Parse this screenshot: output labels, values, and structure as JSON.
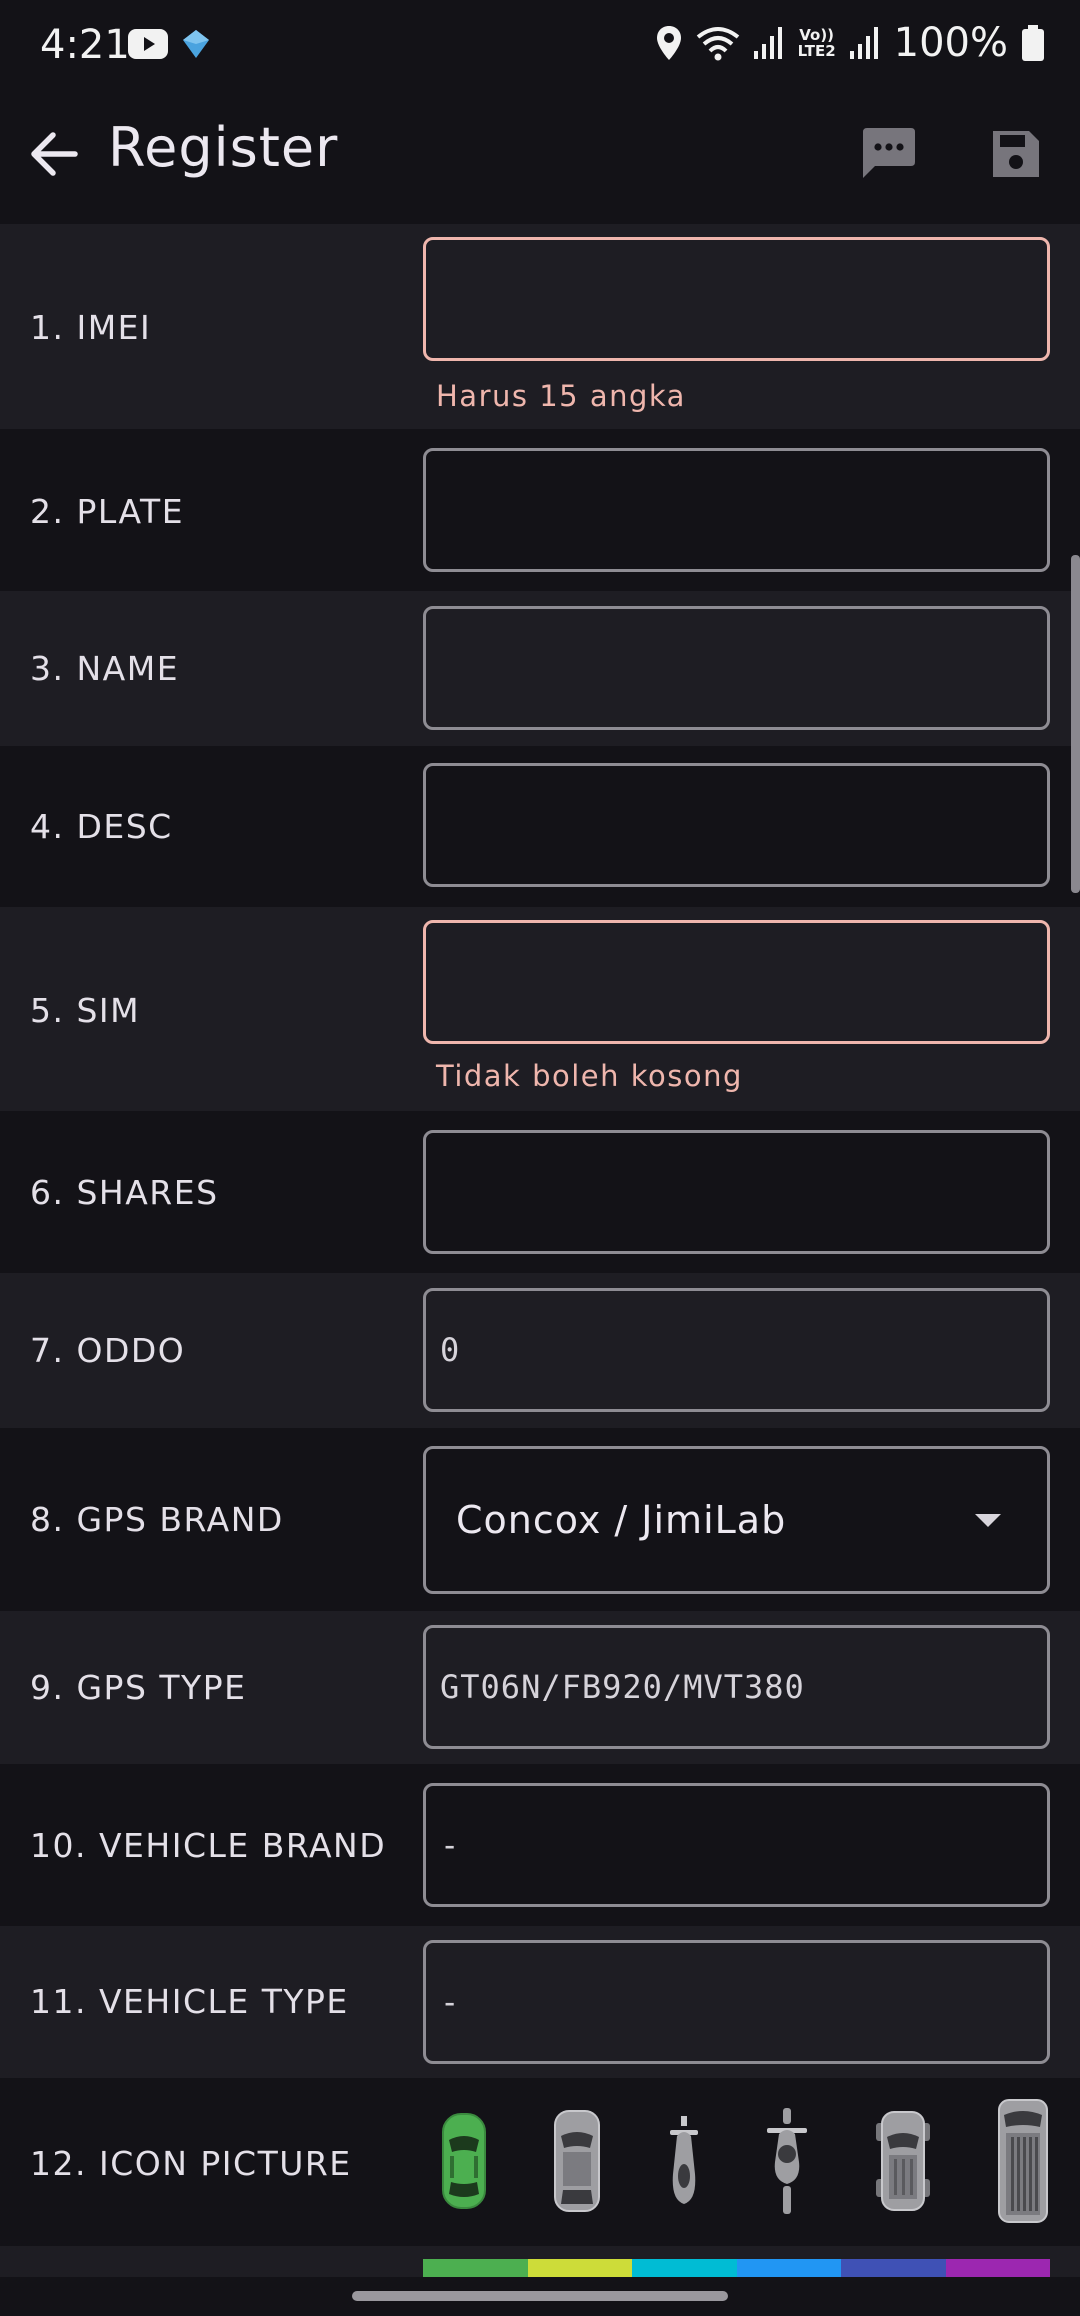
{
  "status_bar": {
    "time": "4:21",
    "battery_text": "100%",
    "network_label_top": "Vo))",
    "network_label_bottom": "LTE2",
    "icons": [
      "youtube-icon",
      "shield-app-icon",
      "location-icon",
      "wifi-icon",
      "signal-icon",
      "signal-icon",
      "battery-icon"
    ]
  },
  "app_bar": {
    "title": "Register",
    "back_icon": "arrow-back-icon",
    "actions": [
      "message-icon",
      "save-icon"
    ]
  },
  "form": {
    "imei": {
      "label": "1. IMEI",
      "value": "",
      "error": "Harus 15 angka"
    },
    "plate": {
      "label": "2. PLATE",
      "value": ""
    },
    "name": {
      "label": "3. NAME",
      "value": ""
    },
    "desc": {
      "label": "4. DESC",
      "value": ""
    },
    "sim": {
      "label": "5. SIM",
      "value": "",
      "error": "Tidak boleh kosong"
    },
    "shares": {
      "label": "6. SHARES",
      "value": ""
    },
    "oddo": {
      "label": "7. ODDO",
      "value": "0"
    },
    "gps_brand": {
      "label": "8. GPS BRAND",
      "selected": "Concox / JimiLab"
    },
    "gps_type": {
      "label": "9. GPS TYPE",
      "value": "GT06N/FB920/MVT380"
    },
    "vehicle_brand": {
      "label": "10. VEHICLE BRAND",
      "value": "-"
    },
    "vehicle_type": {
      "label": "11. VEHICLE TYPE",
      "value": "-"
    },
    "icon_picture": {
      "label": "12. ICON PICTURE",
      "options": [
        "car-icon",
        "suv-icon",
        "scooter-icon",
        "motorcycle-icon",
        "jeep-icon",
        "van-icon"
      ],
      "selected": "car-icon"
    }
  },
  "colors": {
    "accent_selected": "#4caf50",
    "error": "#efb6ad",
    "palette": [
      "#4caf50",
      "#cddc39",
      "#00bcd4",
      "#2196f3",
      "#3f51b5",
      "#9c27b0"
    ]
  }
}
